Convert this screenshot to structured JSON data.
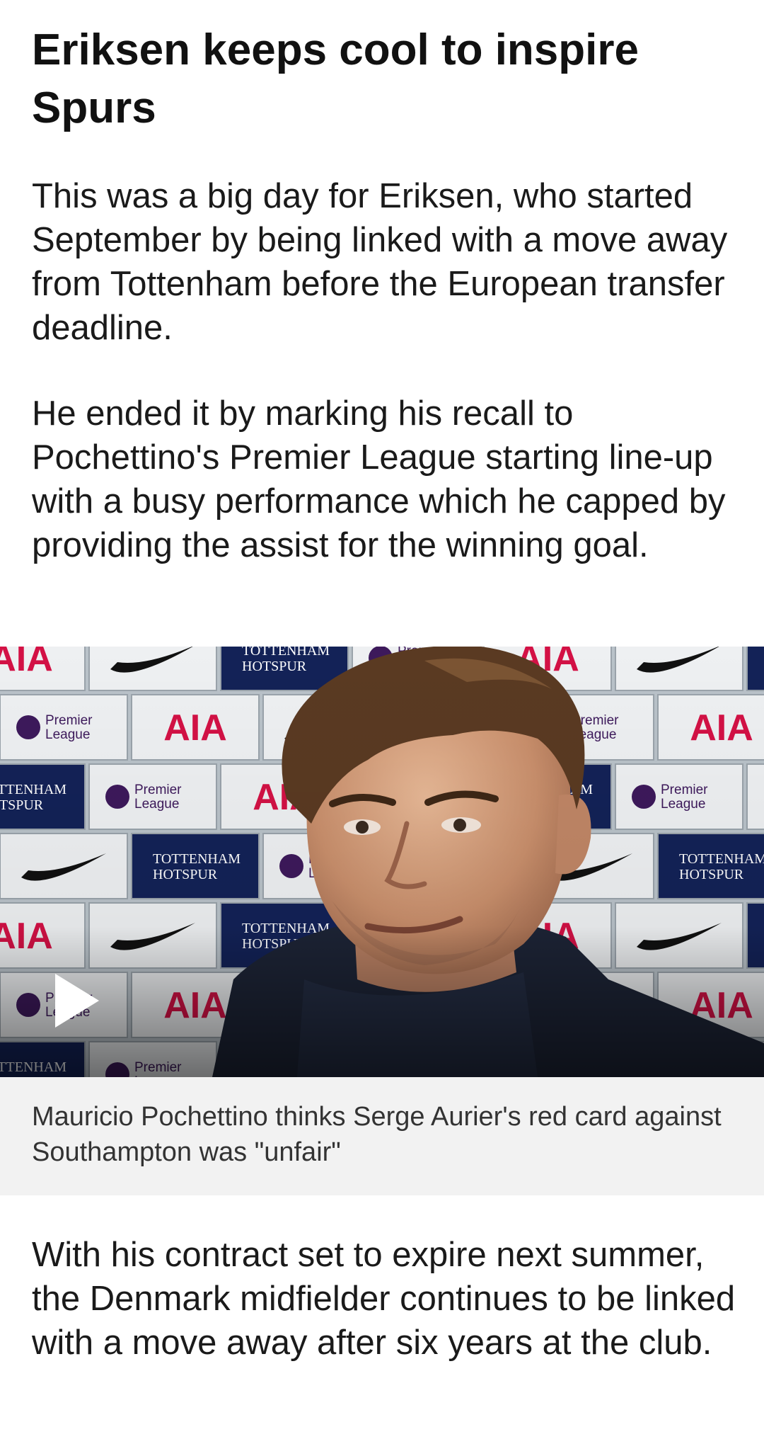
{
  "article": {
    "headline": "Eriksen keeps cool to inspire Spurs",
    "paragraphs": [
      "This was a big day for Eriksen, who started September by being linked with a move away from Tottenham before the European transfer deadline.",
      "He ended it by marking his recall to Pochettino's Premier League starting line-up with a busy performance which he capped by providing the assist for the winning goal.",
      "With his contract set to expire next summer, the Denmark midfielder continues to be linked with a move away after six years at the club."
    ]
  },
  "video": {
    "caption": "Mauricio Pochettino thinks Serge Aurier's red card against Southampton was \"unfair\"",
    "play_icon": "play-icon",
    "backdrop_text": {
      "sponsor": "AIA",
      "league_line1": "Premier",
      "league_line2": "League",
      "club_line1": "TOTTENHAM",
      "club_line2": "HOTSPUR"
    }
  },
  "colors": {
    "text": "#1a1a1a",
    "caption_bg": "#f2f2f2",
    "sponsor_red": "#d31145",
    "club_navy": "#132257"
  }
}
